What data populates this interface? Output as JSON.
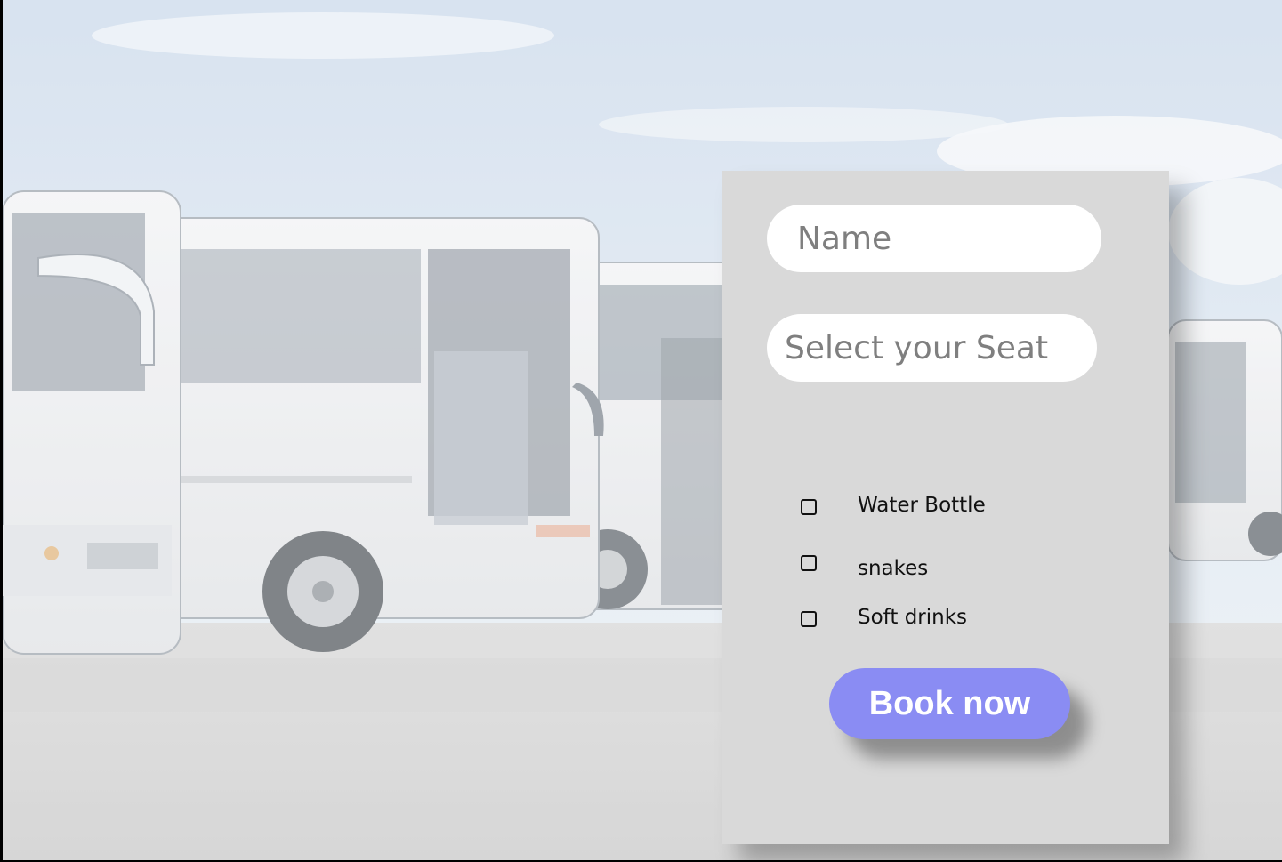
{
  "form": {
    "name_placeholder": "Name",
    "seat_placeholder": "Select your Seat",
    "options": [
      {
        "label": "Water Bottle",
        "checked": false
      },
      {
        "label": "snakes",
        "checked": false
      },
      {
        "label": "Soft drinks",
        "checked": false
      }
    ],
    "submit_label": "Book now"
  },
  "colors": {
    "panel_bg": "#d9d9d9",
    "button_bg": "#8a8cf3",
    "button_text": "#ffffff",
    "input_bg": "#ffffff",
    "sky": "#d5e2f0",
    "pavement": "#cfcfcf"
  },
  "background": {
    "subject": "row-of-white-coach-buses"
  }
}
